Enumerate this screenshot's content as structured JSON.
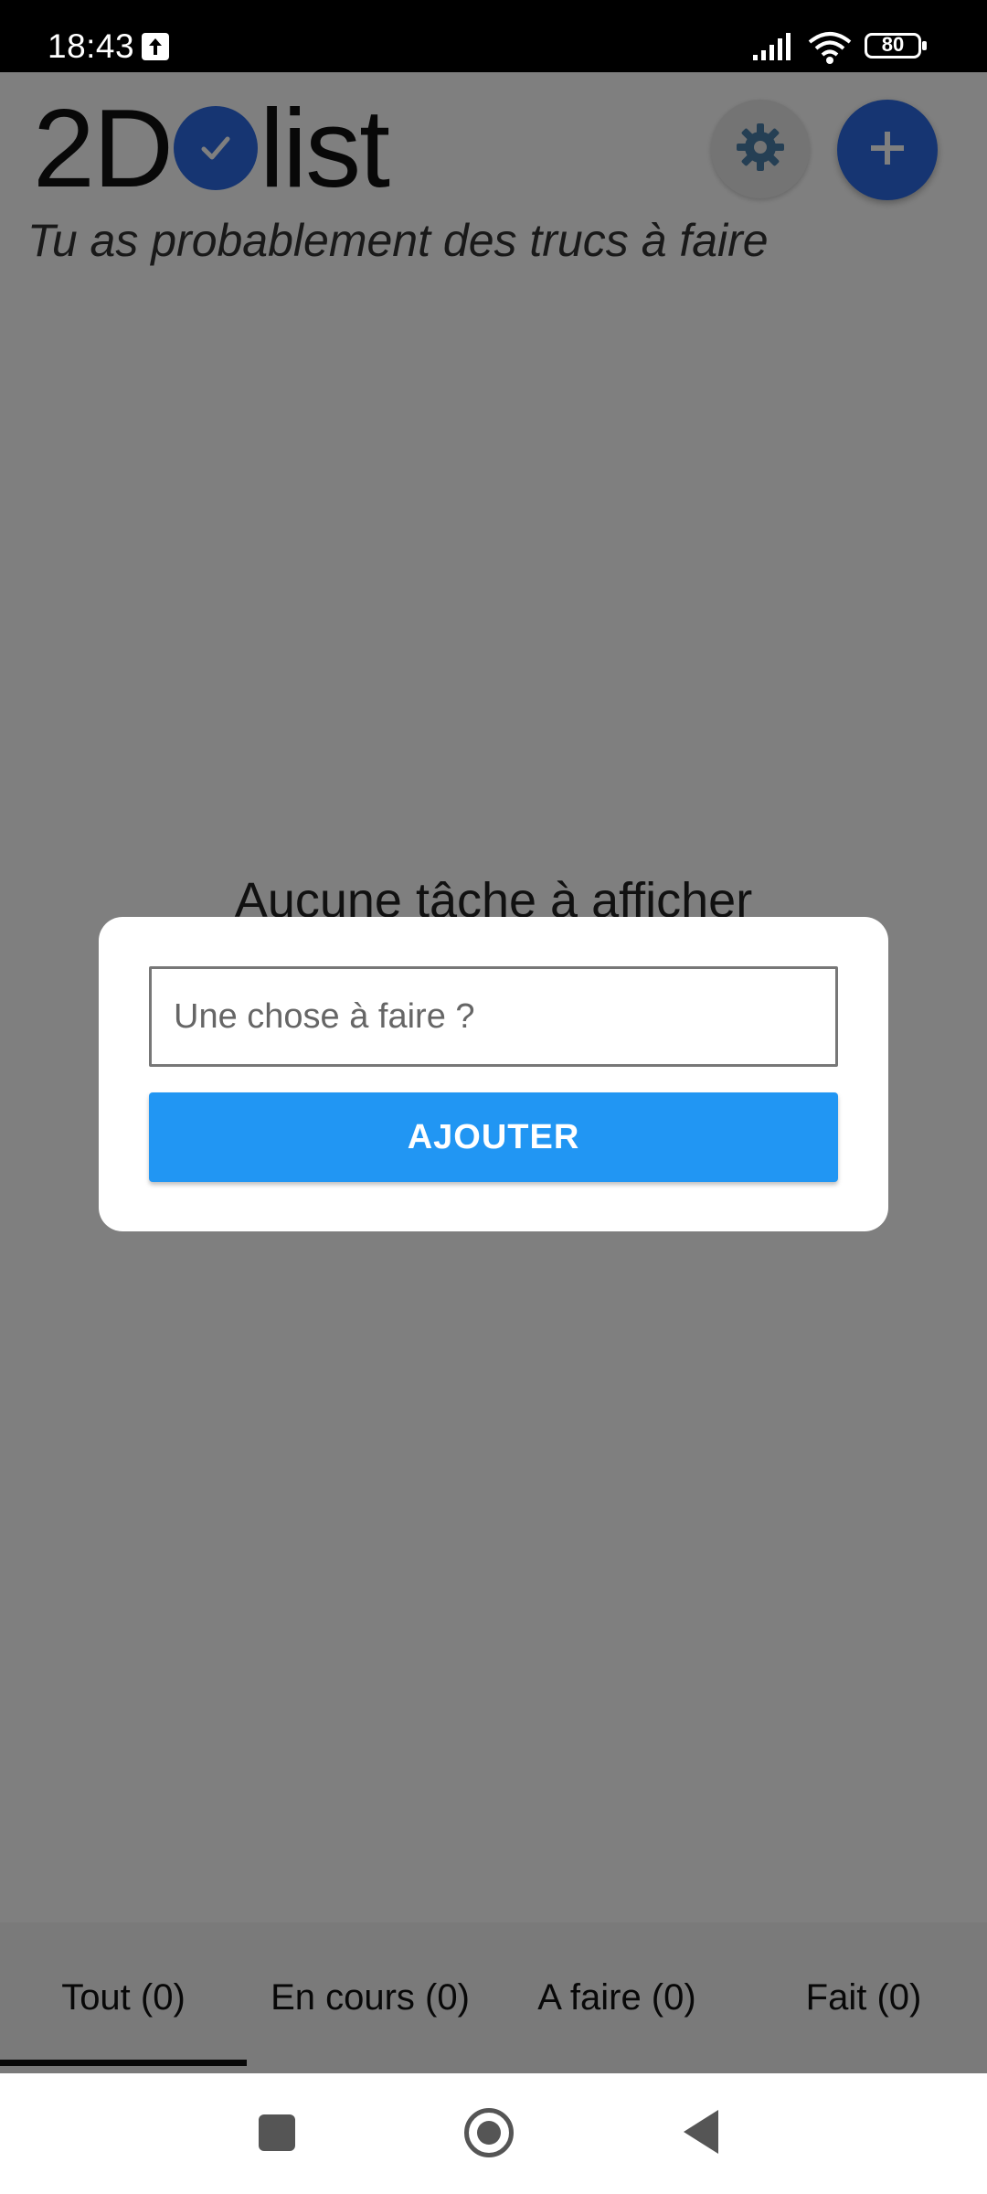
{
  "status_bar": {
    "time": "18:43",
    "battery": "80",
    "icons": [
      "upload-icon",
      "signal-icon",
      "wifi-icon",
      "battery-icon"
    ]
  },
  "app": {
    "logo": {
      "prefix": "2D",
      "suffix": "list",
      "icon": "check-icon",
      "accent_color": "#2d6be4"
    },
    "tagline": "Tu as probablement des trucs à faire",
    "settings_icon": "gear-icon",
    "add_icon": "plus-icon",
    "empty_message": "Aucune tâche à afficher"
  },
  "tabs": [
    {
      "label": "Tout (0)",
      "selected": true
    },
    {
      "label": "En cours (0)",
      "selected": false
    },
    {
      "label": "A faire (0)",
      "selected": false
    },
    {
      "label": "Fait (0)",
      "selected": false
    }
  ],
  "dialog": {
    "input_placeholder": "Une chose à faire ?",
    "input_value": "",
    "add_button_label": "AJOUTER",
    "button_color": "#2196f3"
  },
  "nav_bar": {
    "icons": [
      "recents-icon",
      "home-icon",
      "back-icon"
    ]
  }
}
